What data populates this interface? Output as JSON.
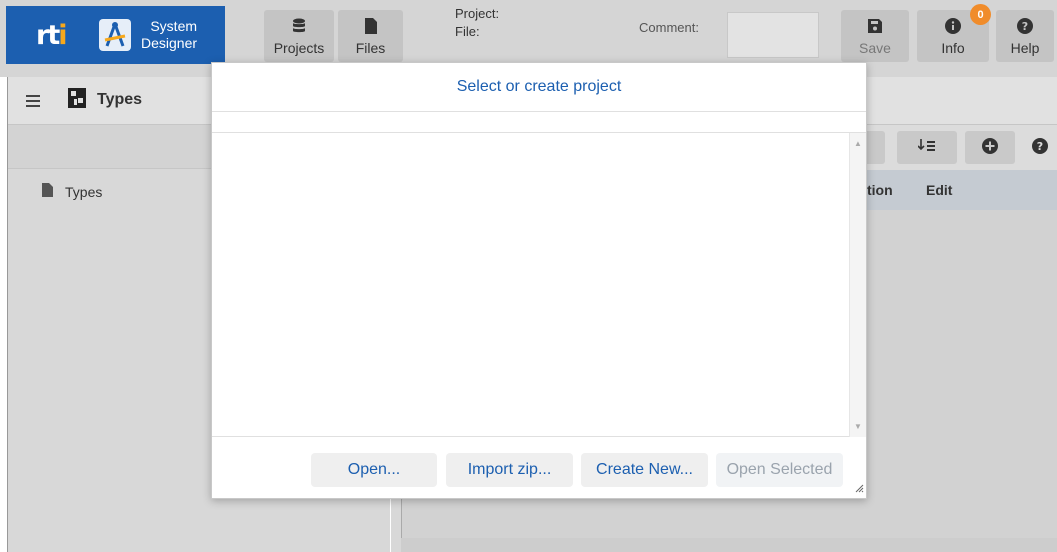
{
  "brand": {
    "logo": "rti",
    "name_line1": "System",
    "name_line2": "Designer"
  },
  "toolbar": {
    "projects_label": "Projects",
    "files_label": "Files",
    "project_label": "Project:",
    "file_label": "File:",
    "comment_label": "Comment:",
    "save_label": "Save",
    "info_label": "Info",
    "info_badge": "0",
    "help_label": "Help"
  },
  "left_panel": {
    "title": "Types",
    "tree_items": [
      {
        "label": "Types",
        "icon": "file-icon"
      }
    ]
  },
  "right_panel": {
    "table_headers": [
      "tion",
      "Edit"
    ]
  },
  "modal": {
    "title": "Select or create project",
    "buttons": {
      "open": "Open...",
      "import_zip": "Import zip...",
      "create_new": "Create New...",
      "open_selected": "Open Selected"
    }
  },
  "colors": {
    "accent": "#1c5fb0",
    "badge": "#f08c2b",
    "toolbar_bg": "#d5d5d5",
    "modal_bg": "#ffffff"
  }
}
